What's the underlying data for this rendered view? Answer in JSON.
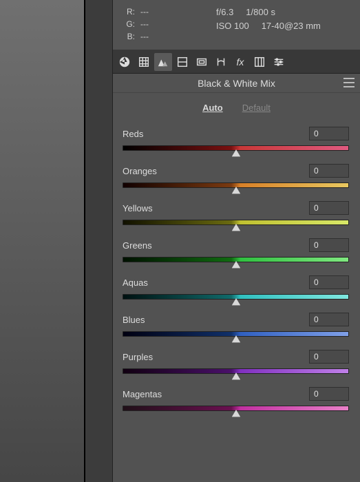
{
  "info": {
    "rgb": {
      "r_label": "R:",
      "r_val": "---",
      "g_label": "G:",
      "g_val": "---",
      "b_label": "B:",
      "b_val": "---"
    },
    "exif": {
      "aperture": "f/6.3",
      "shutter": "1/800 s",
      "iso": "ISO 100",
      "lens": "17-40@23 mm"
    }
  },
  "panel": {
    "title": "Black & White Mix",
    "mode_auto": "Auto",
    "mode_default": "Default"
  },
  "sliders": {
    "reds": {
      "label": "Reds",
      "value": "0"
    },
    "oranges": {
      "label": "Oranges",
      "value": "0"
    },
    "yellows": {
      "label": "Yellows",
      "value": "0"
    },
    "greens": {
      "label": "Greens",
      "value": "0"
    },
    "aquas": {
      "label": "Aquas",
      "value": "0"
    },
    "blues": {
      "label": "Blues",
      "value": "0"
    },
    "purples": {
      "label": "Purples",
      "value": "0"
    },
    "magentas": {
      "label": "Magentas",
      "value": "0"
    }
  }
}
